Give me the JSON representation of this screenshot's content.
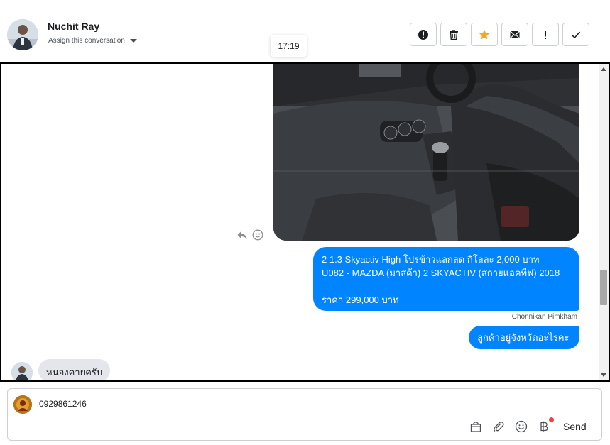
{
  "header": {
    "name": "Nuchit Ray",
    "assign_label": "Assign this conversation",
    "timestamp": "17:19",
    "actions": [
      {
        "name": "spam-button",
        "icon": "alert-circle-icon"
      },
      {
        "name": "delete-button",
        "icon": "trash-icon"
      },
      {
        "name": "star-button",
        "icon": "star-icon",
        "color": "#f5a623"
      },
      {
        "name": "mark-unread-button",
        "icon": "envelope-icon"
      },
      {
        "name": "follow-up-button",
        "icon": "exclamation-icon"
      },
      {
        "name": "done-button",
        "icon": "checkmark-icon"
      }
    ]
  },
  "messages": {
    "listing_line1": "2 1.3 Skyactiv High โปรข้าวแลกลด กิโลละ 2,000 บาท",
    "listing_line2": "U082 - MAZDA (มาสด้า) 2 SKYACTIV (สกายแอคทีฟ) 2018",
    "listing_price": "ราคา 299,000 บาท",
    "sender_name": "Chonnikan Pimkham",
    "outgoing_question": "ลูกค้าอยู่จังหวัดอะไรคะ",
    "incoming_reply": "หนองคายครับ"
  },
  "composer": {
    "value": "0929861246",
    "send_label": "Send"
  },
  "colors": {
    "accent": "#0084ff",
    "incoming_bubble": "#e4e6eb",
    "notification_dot": "#fa3e3e"
  }
}
